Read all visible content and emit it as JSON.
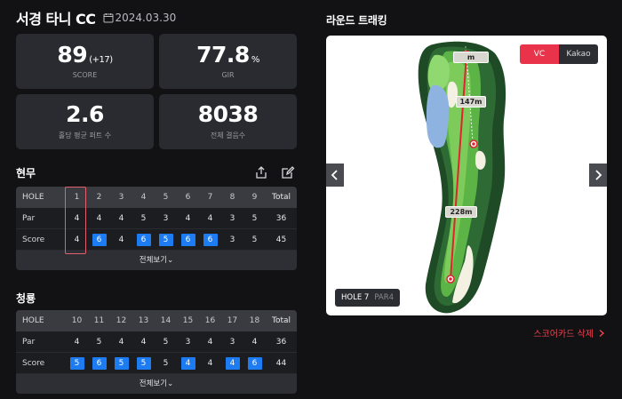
{
  "header": {
    "course": "서경 타니 CC",
    "date": "2024.03.30"
  },
  "stats": [
    {
      "value": "89",
      "sub": "(+17)",
      "label": "SCORE"
    },
    {
      "value": "77.8",
      "sub": "%",
      "label": "GIR"
    },
    {
      "value": "2.6",
      "sub": "",
      "label": "홀당 평균 퍼트 수"
    },
    {
      "value": "8038",
      "sub": "",
      "label": "전체 결음수"
    }
  ],
  "course1": {
    "title": "현무",
    "head": [
      "HOLE",
      "1",
      "2",
      "3",
      "4",
      "5",
      "6",
      "7",
      "8",
      "9",
      "Total"
    ],
    "par": [
      "Par",
      "4",
      "4",
      "4",
      "5",
      "3",
      "4",
      "4",
      "3",
      "5",
      "36"
    ],
    "score": [
      "Score",
      "4",
      "6",
      "4",
      "6",
      "5",
      "6",
      "6",
      "3",
      "5",
      "45"
    ],
    "highlight": [
      false,
      true,
      false,
      true,
      true,
      true,
      true,
      false,
      false
    ],
    "expand": "전체보기⌄"
  },
  "course2": {
    "title": "청룡",
    "head": [
      "HOLE",
      "10",
      "11",
      "12",
      "13",
      "14",
      "15",
      "16",
      "17",
      "18",
      "Total"
    ],
    "par": [
      "Par",
      "4",
      "5",
      "4",
      "4",
      "5",
      "3",
      "4",
      "3",
      "4",
      "36"
    ],
    "score": [
      "Score",
      "5",
      "6",
      "5",
      "5",
      "5",
      "4",
      "4",
      "4",
      "6",
      "44"
    ],
    "highlight": [
      true,
      true,
      true,
      true,
      false,
      true,
      false,
      true,
      true
    ],
    "expand": "전체보기⌄"
  },
  "tracking": {
    "title": "라운드 트래킹",
    "toggle": [
      "VC",
      "Kakao"
    ],
    "distances": [
      "m",
      "147m",
      "228m"
    ],
    "hole": "HOLE 7",
    "par": "PAR4"
  },
  "delete_label": "스코어카드 삭제",
  "colors": {
    "accent": "#e8334a",
    "highlight_blue": "#1d7cf2",
    "card": "#2a2b30"
  }
}
